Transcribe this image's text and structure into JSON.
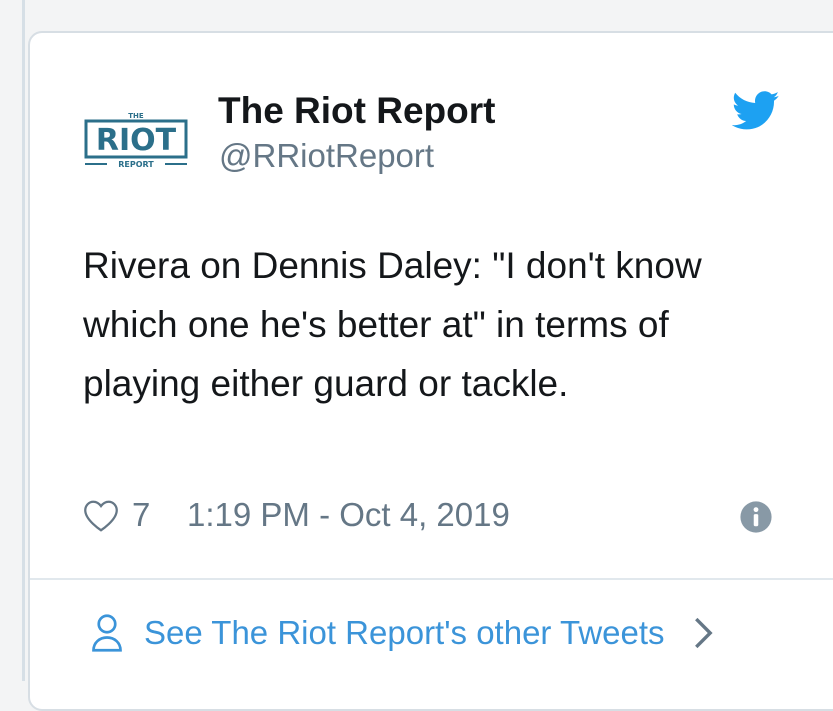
{
  "author": {
    "name": "The Riot Report",
    "handle": "@RRiotReport"
  },
  "logo": {
    "top_text": "THE",
    "main_text": "RIOT",
    "bottom_text": "REPORT"
  },
  "tweet": {
    "text": "Rivera on Dennis Daley: \"I don't know which one he's better at\" in terms of playing either guard or tackle.",
    "likes": "7",
    "timestamp": "1:19 PM - Oct 4, 2019"
  },
  "footer": {
    "see_more_label": "See The Riot Report's other Tweets"
  },
  "icons": {
    "brand": "twitter-bird-icon",
    "like": "heart-icon",
    "info": "info-icon",
    "profile": "person-icon",
    "more": "chevron-right-icon"
  },
  "colors": {
    "twitter_blue": "#1da1f2",
    "link_blue": "#3b94d9",
    "logo_blue": "#2b6f8a",
    "text_primary": "#14171a",
    "text_secondary": "#657786",
    "border": "#d7dee4"
  }
}
